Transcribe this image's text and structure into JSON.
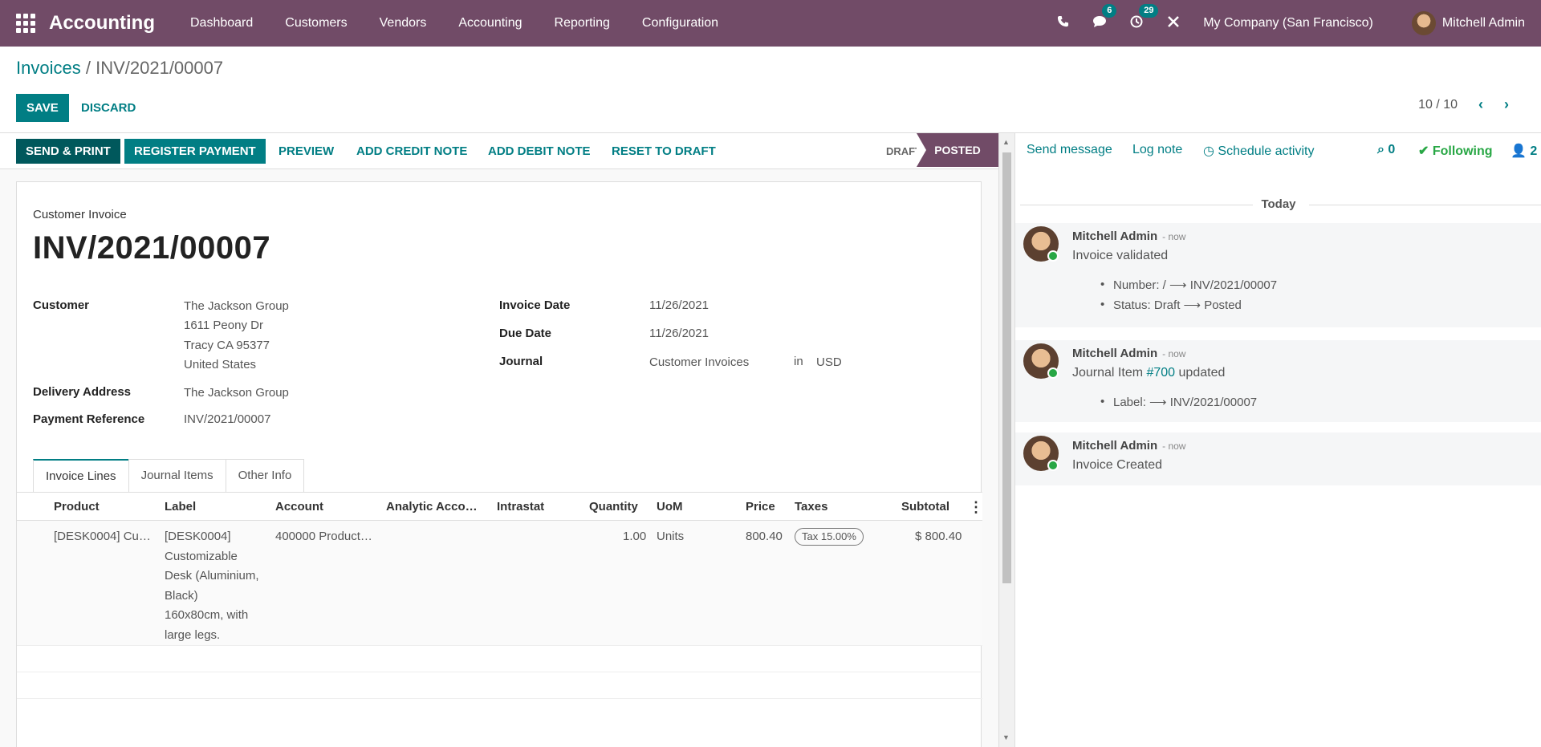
{
  "nav": {
    "brand": "Accounting",
    "menu": [
      "Dashboard",
      "Customers",
      "Vendors",
      "Accounting",
      "Reporting",
      "Configuration"
    ],
    "messages_badge": "6",
    "activities_badge": "29",
    "company": "My Company (San Francisco)",
    "user": "Mitchell Admin"
  },
  "breadcrumb": {
    "parent": "Invoices",
    "separator": "/",
    "current": "INV/2021/00007"
  },
  "actions": {
    "save": "SAVE",
    "discard": "DISCARD"
  },
  "pager": {
    "value": "10 / 10",
    "prev": "‹",
    "next": "›"
  },
  "statusbar": {
    "buttons": [
      "SEND & PRINT",
      "REGISTER PAYMENT",
      "PREVIEW",
      "ADD CREDIT NOTE",
      "ADD DEBIT NOTE",
      "RESET TO DRAFT"
    ],
    "stages": [
      "DRAFT",
      "POSTED"
    ]
  },
  "invoice": {
    "kind": "Customer Invoice",
    "name": "INV/2021/00007",
    "customer_label": "Customer",
    "customer": "The Jackson Group",
    "address": [
      "1611 Peony Dr",
      "Tracy CA 95377",
      "United States"
    ],
    "delivery_label": "Delivery Address",
    "delivery": "The Jackson Group",
    "payref_label": "Payment Reference",
    "payref": "INV/2021/00007",
    "date_label": "Invoice Date",
    "date": "11/26/2021",
    "due_label": "Due Date",
    "due": "11/26/2021",
    "journal_label": "Journal",
    "journal": "Customer Invoices",
    "in": "in",
    "currency": "USD"
  },
  "tabs": [
    "Invoice Lines",
    "Journal Items",
    "Other Info"
  ],
  "lines": {
    "headers": [
      "Product",
      "Label",
      "Account",
      "Analytic Acco…",
      "Intrastat",
      "Quantity",
      "UoM",
      "Price",
      "Taxes",
      "Subtotal"
    ],
    "rows": [
      {
        "product": "[DESK0004] Cu…",
        "label": [
          "[DESK0004]",
          "Customizable",
          "Desk (Aluminium,",
          "Black)",
          "160x80cm, with",
          "large legs."
        ],
        "account": "400000 Product…",
        "analytic": "",
        "intrastat": "",
        "quantity": "1.00",
        "uom": "Units",
        "price": "800.40",
        "taxes": "Tax 15.00%",
        "subtotal": "$ 800.40"
      }
    ]
  },
  "chatter": {
    "send_message": "Send message",
    "log_note": "Log note",
    "schedule": "Schedule activity",
    "attachments": "0",
    "following": "Following",
    "followers": "2",
    "day": "Today",
    "messages": [
      {
        "author": "Mitchell Admin",
        "date": "- now",
        "body": "Invoice validated",
        "changes": [
          "Number: / ⟶ INV/2021/00007",
          "Status: Draft ⟶ Posted"
        ]
      },
      {
        "author": "Mitchell Admin",
        "date": "- now",
        "body_prefix": "Journal Item ",
        "body_link": "#700",
        "body_suffix": " updated",
        "changes": [
          "Label: ⟶ INV/2021/00007"
        ]
      },
      {
        "author": "Mitchell Admin",
        "date": "- now",
        "body": "Invoice Created",
        "changes": []
      }
    ]
  },
  "colors": {
    "brand": "#714b67",
    "primary": "#017e84"
  }
}
